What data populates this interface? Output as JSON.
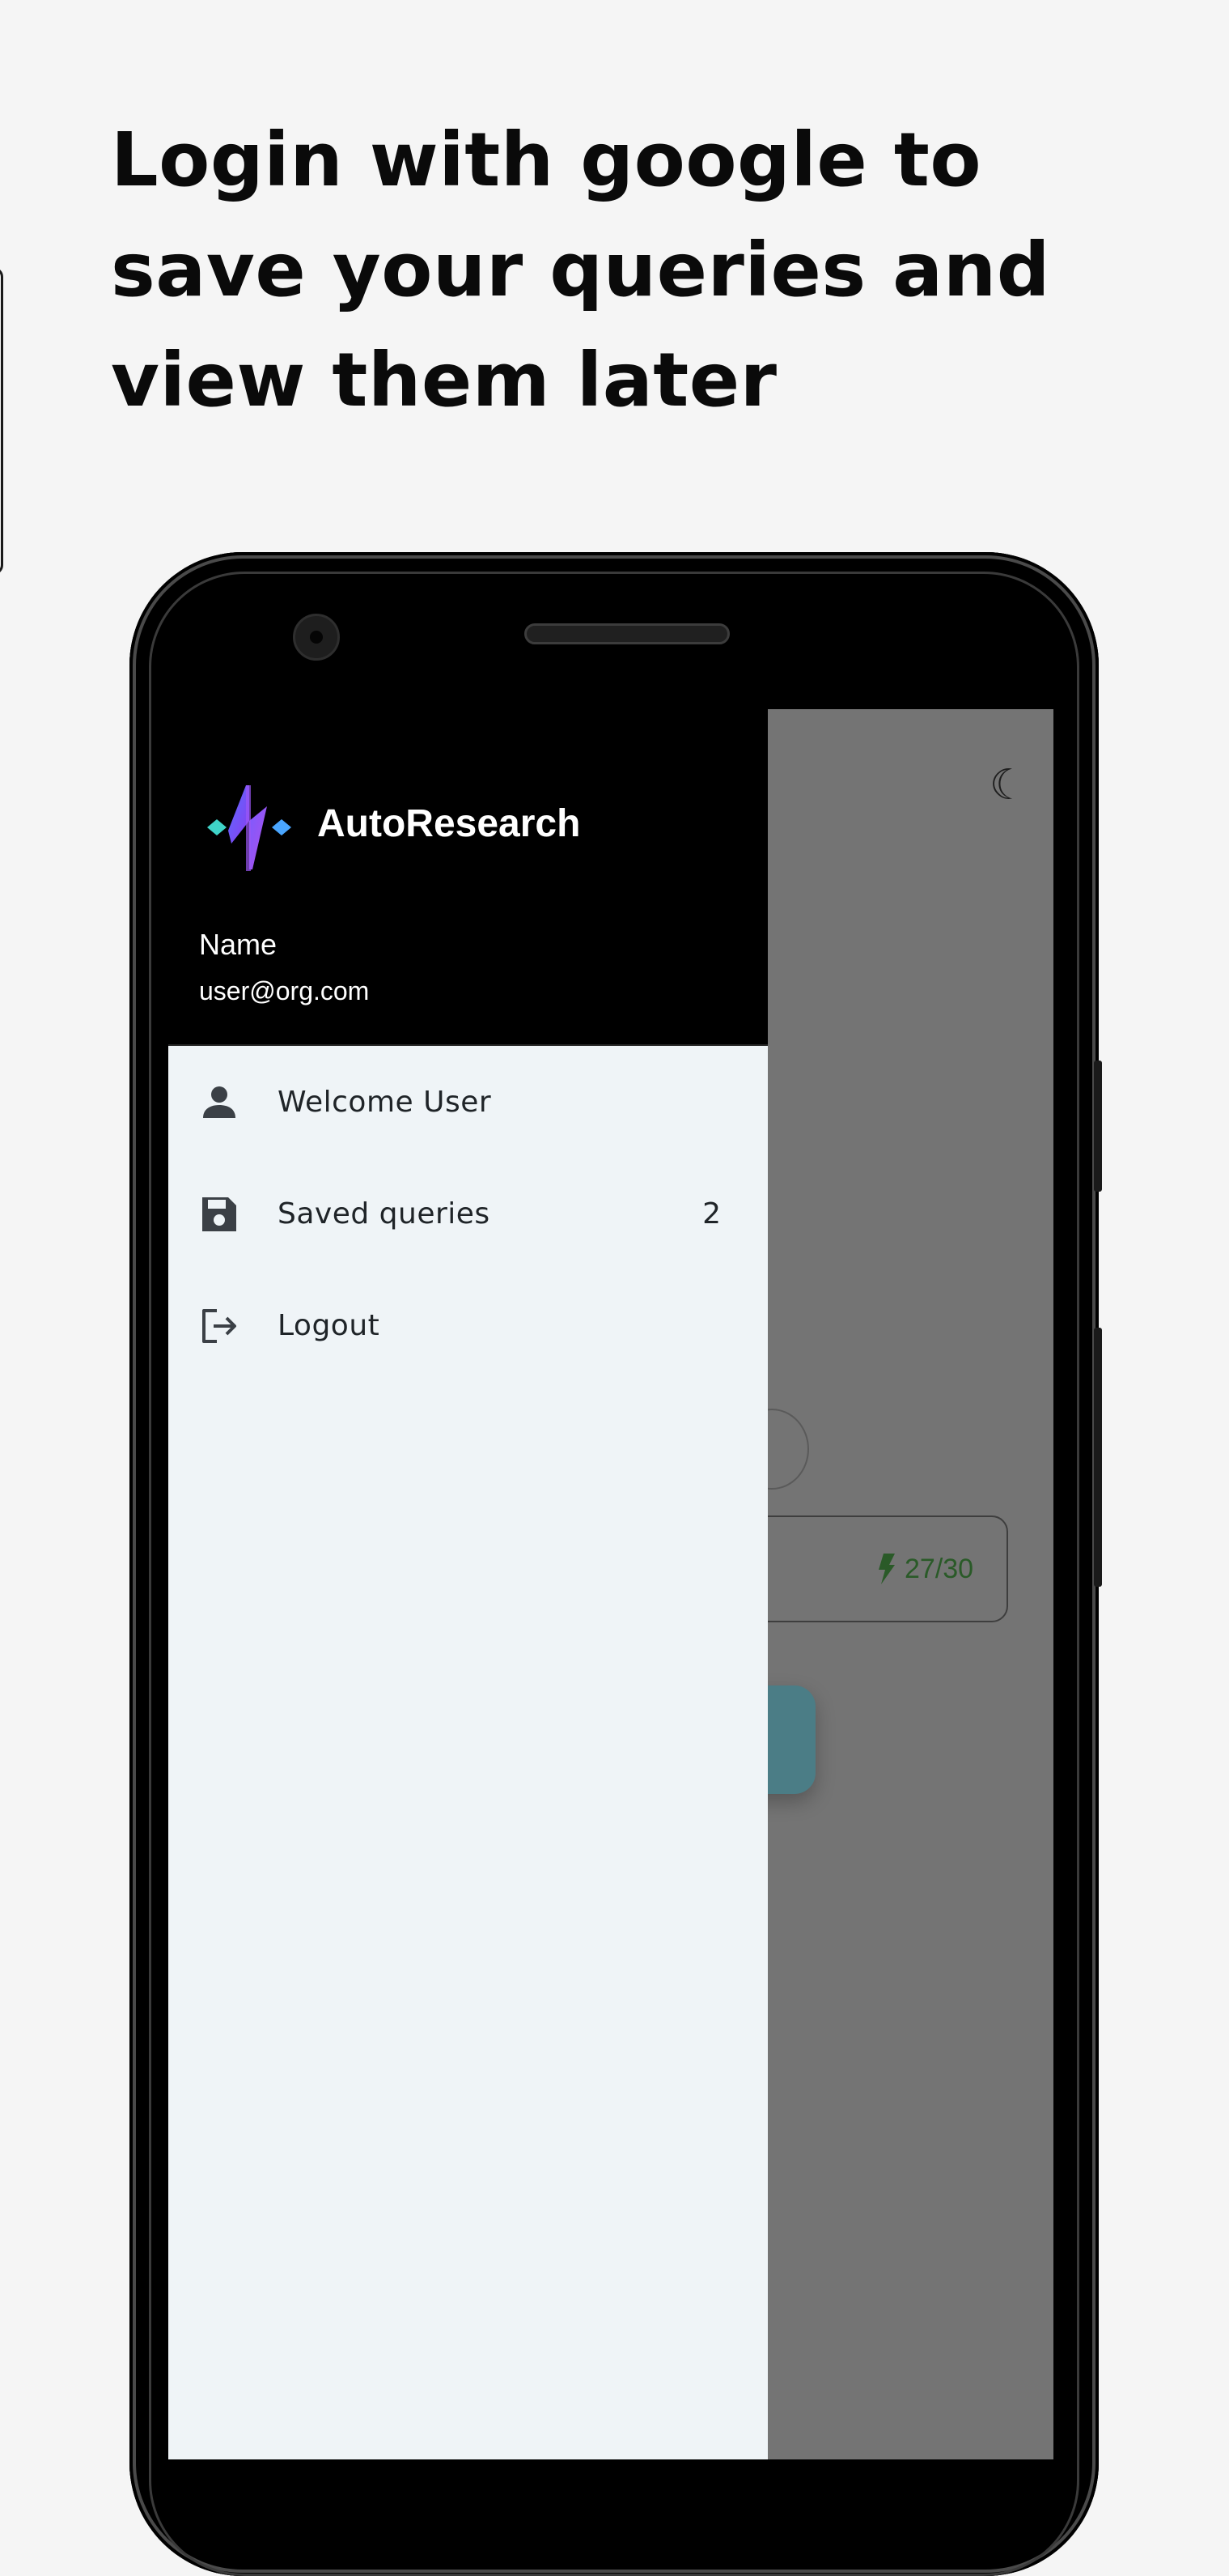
{
  "headline": "Login with google to save your queries and view them later",
  "app": {
    "name": "AutoResearch",
    "logo_icon": "autoresearch-logo",
    "theme_toggle_icon": "moon-icon"
  },
  "user": {
    "name": "Name",
    "email": "user@org.com"
  },
  "drawer_menu": [
    {
      "icon": "person-icon",
      "label": "Welcome User",
      "count": ""
    },
    {
      "icon": "save-icon",
      "label": "Saved queries",
      "count": "2"
    },
    {
      "icon": "logout-icon",
      "label": "Logout",
      "count": ""
    }
  ],
  "background_app": {
    "query_counter": "27/30",
    "counter_icon": "bolt-icon"
  },
  "colors": {
    "drawer_header": "#000000",
    "drawer_body": "#eff4f7",
    "scrim": "#747474",
    "counter_text": "#2a5a28",
    "fab": "#4b7d86"
  }
}
